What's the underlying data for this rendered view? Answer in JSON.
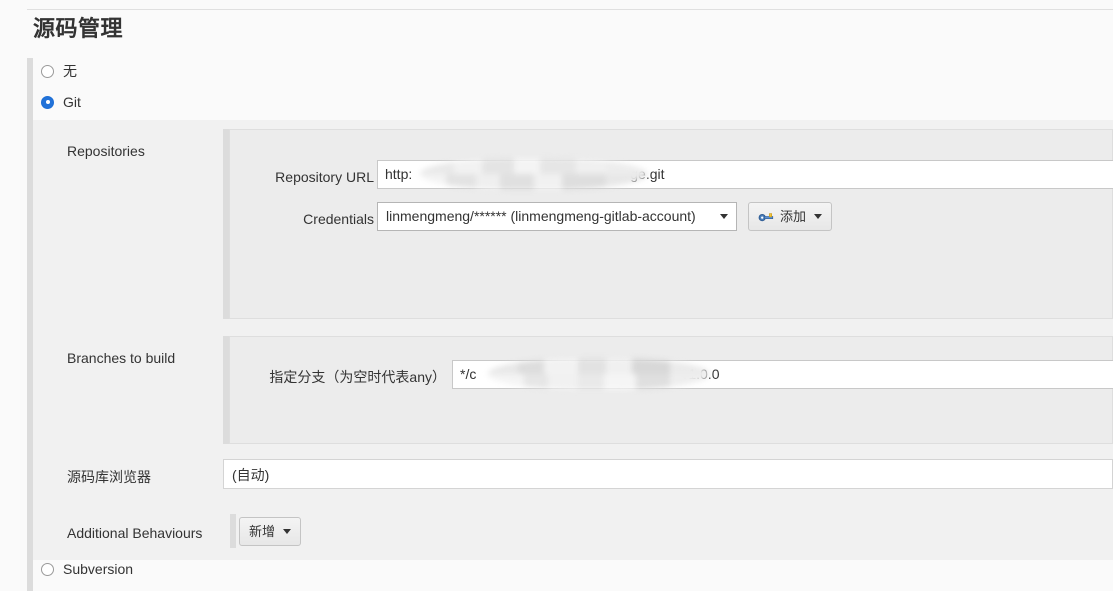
{
  "page": {
    "title": "源码管理"
  },
  "scm_options": [
    {
      "label": "无",
      "selected": false
    },
    {
      "label": "Git",
      "selected": true
    },
    {
      "label": "Subversion",
      "selected": false
    }
  ],
  "git": {
    "repositories": {
      "section_label": "Repositories",
      "repository_url": {
        "label": "Repository URL",
        "value_prefix": "http:",
        "value_suffix": "ge.git",
        "redacted": true
      },
      "credentials": {
        "label": "Credentials",
        "value": "linmengmeng/****** (linmengmeng-gitlab-account)",
        "options": [
          "linmengmeng/****** (linmengmeng-gitlab-account)"
        ]
      },
      "add_button": {
        "label": "添加",
        "icon": "key-icon"
      }
    },
    "branches": {
      "section_label": "Branches to build",
      "branch_specifier": {
        "label": "指定分支（为空时代表any）",
        "value_prefix": "*/c",
        "value_suffix": "v1.0.0",
        "redacted": true
      }
    },
    "repository_browser": {
      "label": "源码库浏览器",
      "value": "(自动)"
    },
    "additional_behaviours": {
      "label": "Additional Behaviours",
      "add_button_label": "新增"
    }
  },
  "colors": {
    "accent": "#2272d8",
    "page_background": "#fafafa",
    "panel_background": "#f1f1f1",
    "subpanel_background": "#ececec",
    "gutter": "#dcdcdc"
  }
}
